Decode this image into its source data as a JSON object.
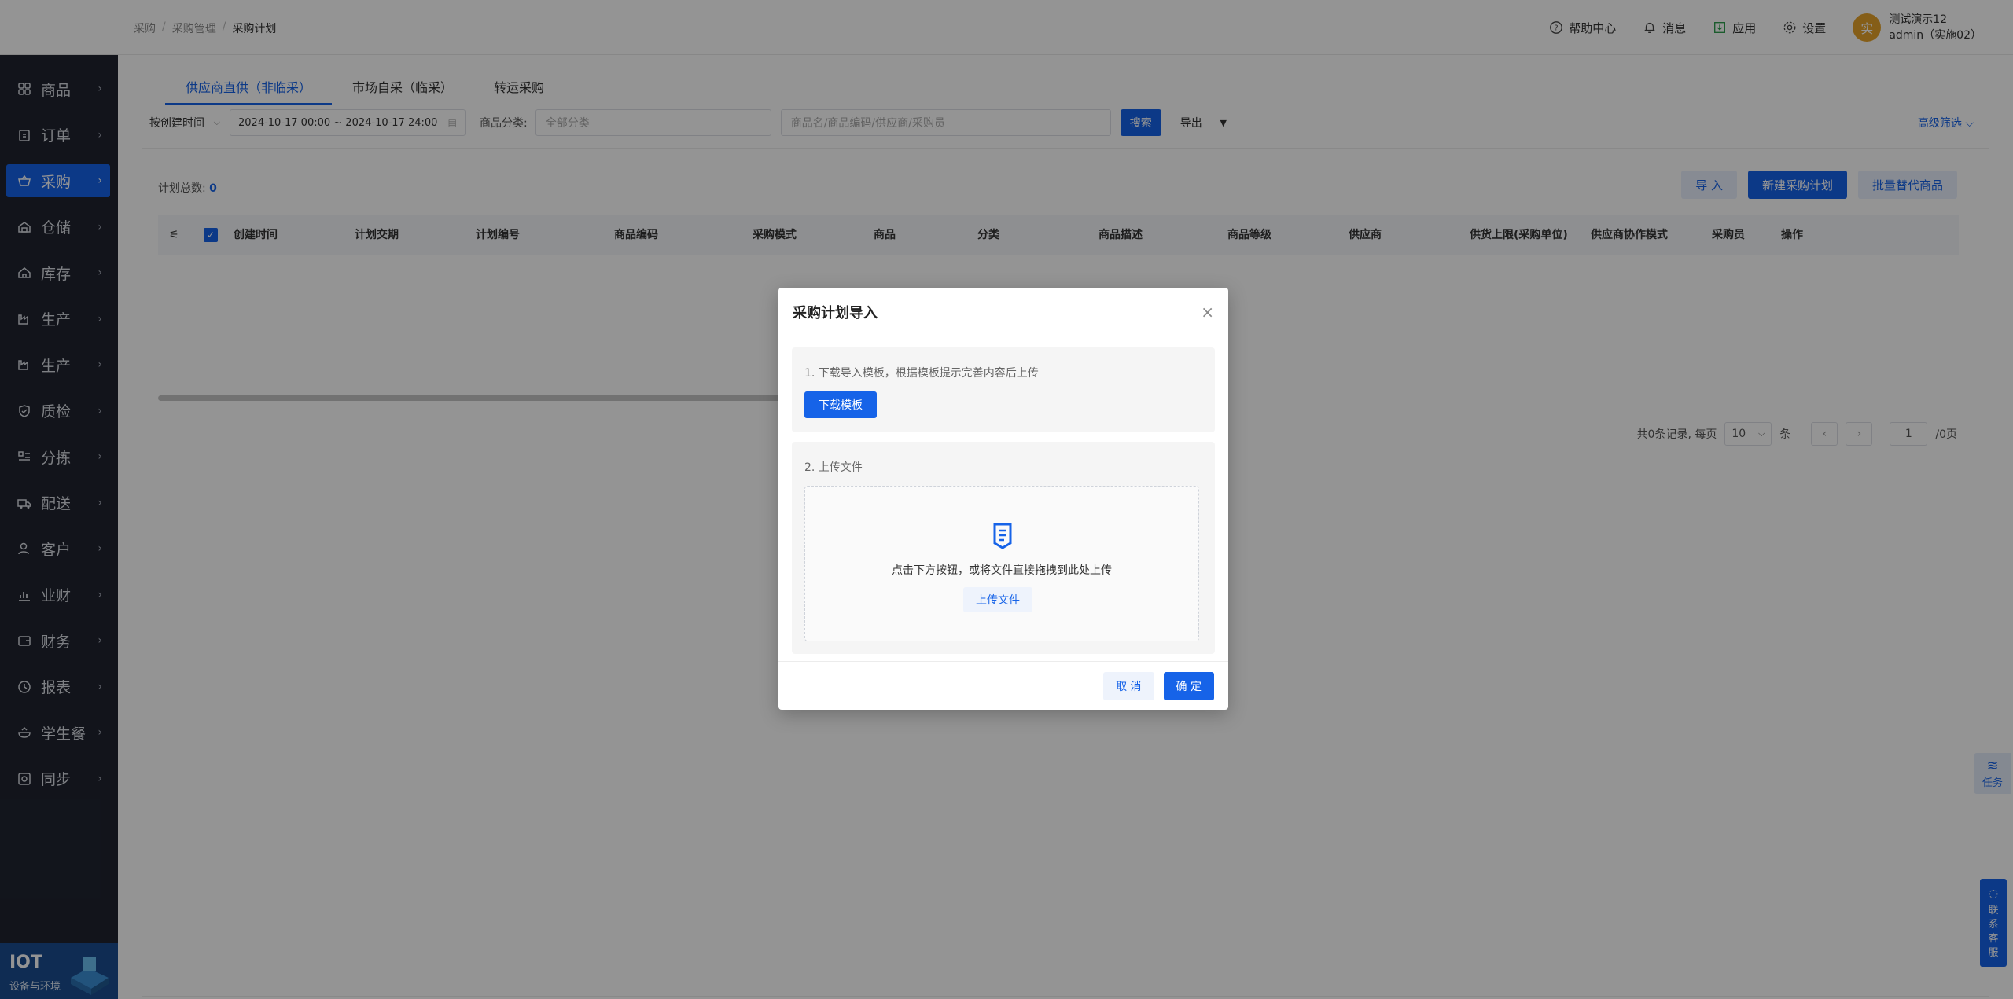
{
  "sidebar": {
    "items": [
      {
        "label": "商品",
        "icon": "grid-icon"
      },
      {
        "label": "订单",
        "icon": "clipboard-icon"
      },
      {
        "label": "采购",
        "icon": "basket-icon",
        "active": true
      },
      {
        "label": "仓储",
        "icon": "warehouse-icon"
      },
      {
        "label": "库存",
        "icon": "home-icon"
      },
      {
        "label": "生产",
        "icon": "factory-icon"
      },
      {
        "label": "生产",
        "icon": "factory-icon"
      },
      {
        "label": "质检",
        "icon": "shield-icon"
      },
      {
        "label": "分拣",
        "icon": "sort-icon"
      },
      {
        "label": "配送",
        "icon": "truck-icon"
      },
      {
        "label": "客户",
        "icon": "user-icon"
      },
      {
        "label": "业财",
        "icon": "chart-icon"
      },
      {
        "label": "财务",
        "icon": "wallet-icon"
      },
      {
        "label": "报表",
        "icon": "clock-icon"
      },
      {
        "label": "学生餐",
        "icon": "bowl-icon"
      },
      {
        "label": "同步",
        "icon": "sync-icon"
      }
    ],
    "iot": {
      "title": "IOT",
      "subtitle": "设备与环境"
    }
  },
  "header": {
    "breadcrumb": [
      "采购",
      "采购管理",
      "采购计划"
    ],
    "help": "帮助中心",
    "messages": "消息",
    "apps": "应用",
    "settings": "设置",
    "avatar_char": "实",
    "user_name": "测试演示12",
    "user_role": "admin（实施02）"
  },
  "tabs": [
    "供应商直供（非临采）",
    "市场自采（临采）",
    "转运采购"
  ],
  "filters": {
    "time_type": "按创建时间",
    "date_range": "2024-10-17 00:00 ~ 2024-10-17 24:00",
    "category_label": "商品分类:",
    "category_placeholder": "全部分类",
    "search_placeholder": "商品名/商品编码/供应商/采购员",
    "search_btn": "搜索",
    "export_btn": "导出",
    "advanced": "高级筛选"
  },
  "summary": {
    "label": "计划总数:",
    "count": "0"
  },
  "actions": {
    "import": "导 入",
    "new_plan": "新建采购计划",
    "batch_replace": "批量替代商品"
  },
  "table": {
    "columns": [
      "创建时间",
      "计划交期",
      "计划编号",
      "商品编码",
      "采购模式",
      "商品",
      "分类",
      "商品描述",
      "商品等级",
      "供应商",
      "供货上限(采购单位)",
      "供应商协作模式",
      "采购员",
      "操作"
    ]
  },
  "pager": {
    "total_text": "共0条记录, 每页",
    "page_size": "10",
    "unit": "条",
    "page": "1",
    "pages_text": "/0页"
  },
  "floats": {
    "task": "任务",
    "service": [
      "联",
      "系",
      "客",
      "服"
    ]
  },
  "modal": {
    "title": "采购计划导入",
    "step1_label": "1. 下载导入模板，根据模板提示完善内容后上传",
    "download_btn": "下载模板",
    "step2_label": "2. 上传文件",
    "drop_text": "点击下方按钮，或将文件直接拖拽到此处上传",
    "upload_btn": "上传文件",
    "cancel": "取 消",
    "ok": "确 定"
  },
  "colors": {
    "primary": "#1663e8",
    "sidebar_bg": "#1f2430"
  }
}
